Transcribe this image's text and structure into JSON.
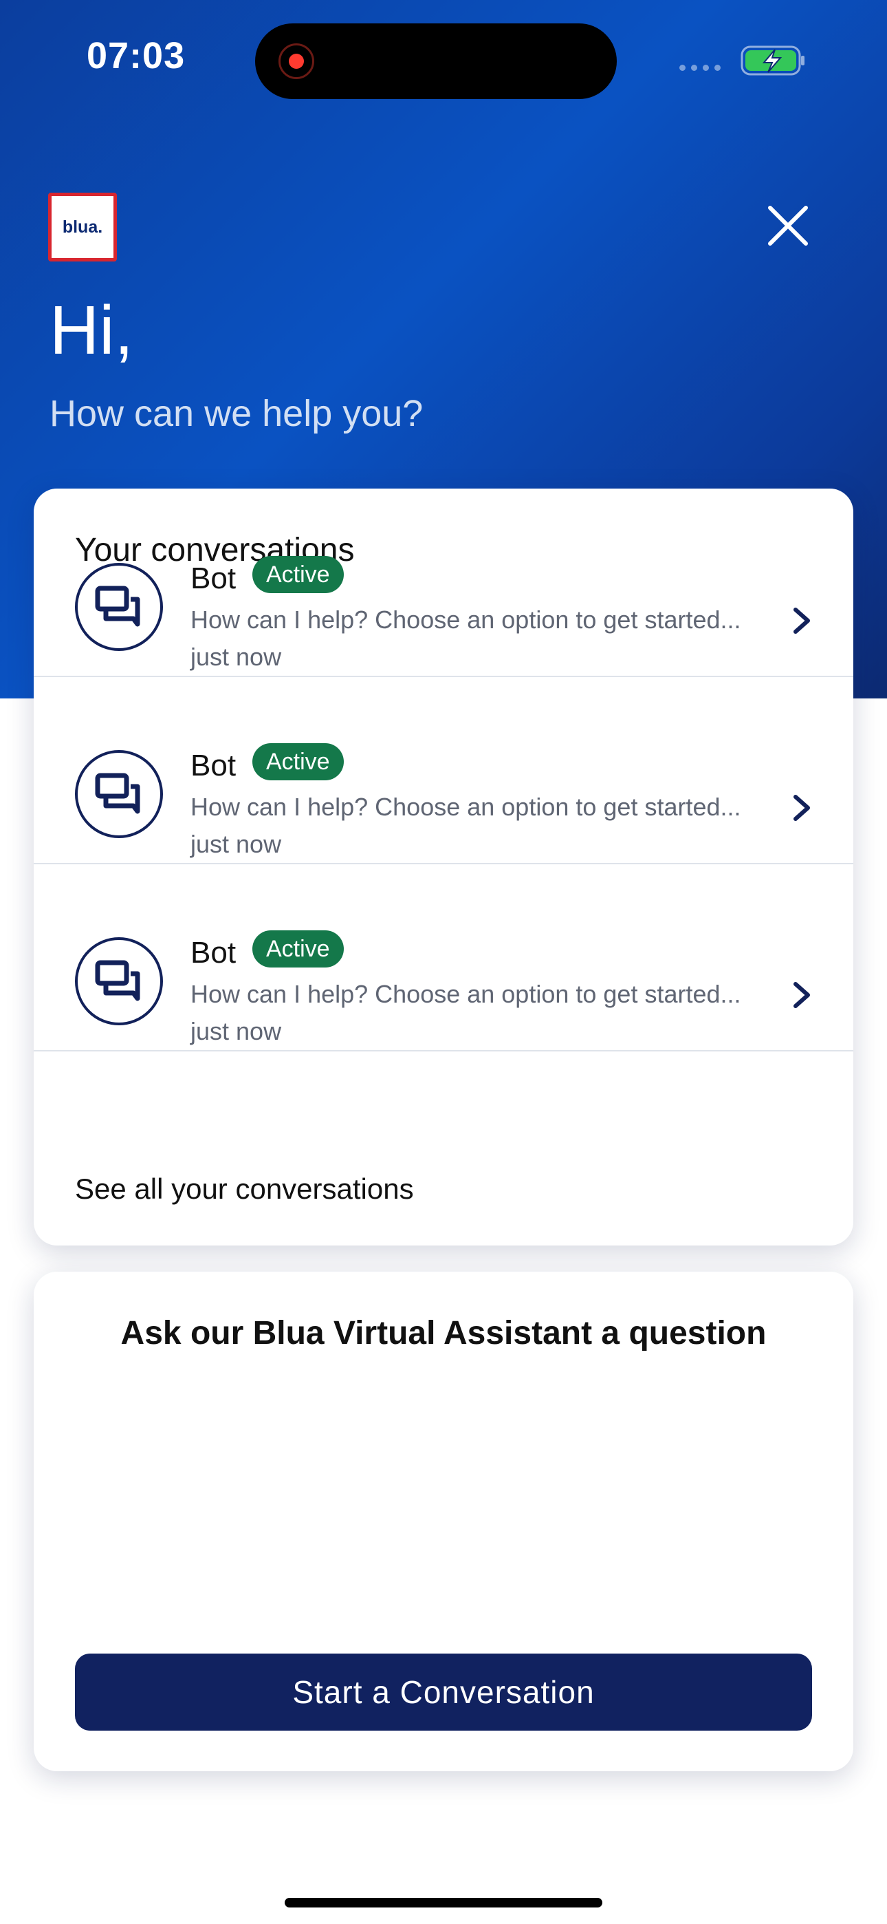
{
  "status_bar": {
    "time": "07:03"
  },
  "header": {
    "logo_text": "blua.",
    "greeting": "Hi,",
    "subtitle": "How can we help you?"
  },
  "conversations": {
    "title": "Your conversations",
    "items": [
      {
        "name": "Bot",
        "status": "Active",
        "preview": "How can I help? Choose an option to get started...",
        "time": "just now"
      },
      {
        "name": "Bot",
        "status": "Active",
        "preview": "How can I help? Choose an option to get started...",
        "time": "just now"
      },
      {
        "name": "Bot",
        "status": "Active",
        "preview": "How can I help? Choose an option to get started...",
        "time": "just now"
      }
    ],
    "see_all": "See all your conversations"
  },
  "assistant": {
    "title": "Ask our Blua Virtual Assistant a question",
    "button": "Start a Conversation"
  },
  "colors": {
    "hero_blue": "#0a52c2",
    "navy": "#112260",
    "active_green": "#14784a",
    "logo_red": "#d8262f"
  },
  "icons": [
    "record-icon",
    "signal-icon",
    "battery-charging-icon",
    "close-icon",
    "chat-bubbles-icon",
    "chevron-right-icon"
  ]
}
